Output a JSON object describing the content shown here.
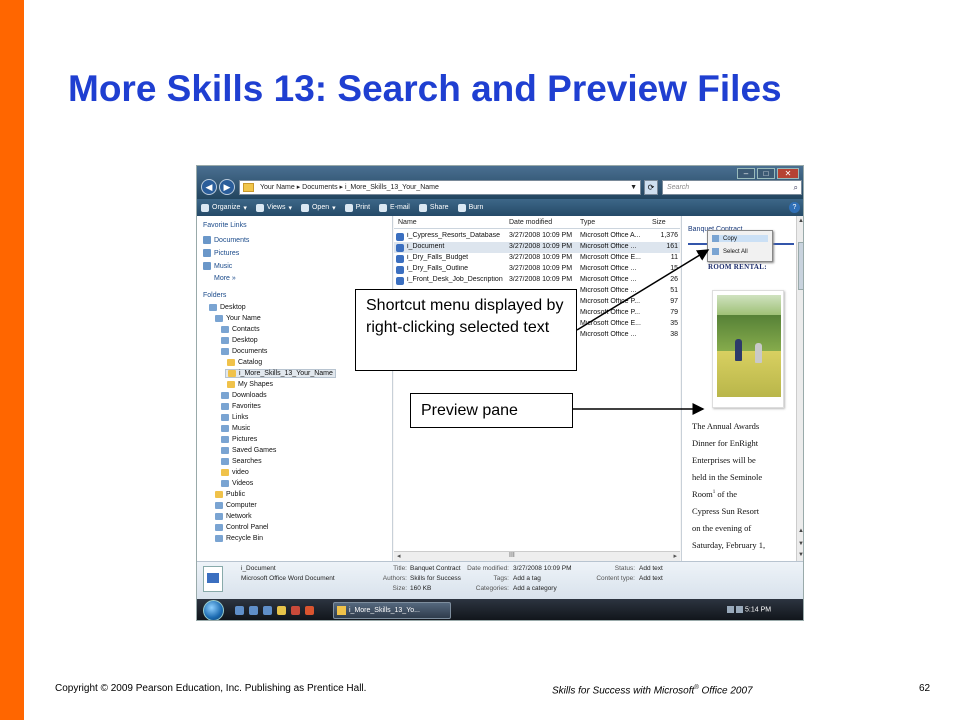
{
  "slide": {
    "title": "More Skills 13: Search and Preview Files",
    "footer_left": "Copyright © 2009 Pearson Education, Inc. Publishing as Prentice Hall.",
    "footer_center_prefix": "Skills for Success with Microsoft",
    "footer_center_mark": "®",
    "footer_center_suffix": " Office 2007",
    "page_number": "62",
    "accent_color": "#ff6600",
    "title_color": "#1f3fd1"
  },
  "callouts": {
    "shortcut_menu": "Shortcut menu displayed by right-clicking selected text",
    "preview_pane": "Preview pane"
  },
  "window": {
    "address": "Your Name  ▸  Documents  ▸  i_More_Skills_13_Your_Name",
    "search_placeholder": "Search",
    "toolbar": {
      "organize": "Organize",
      "views": "Views",
      "open": "Open",
      "print": "Print",
      "email": "E-mail",
      "share": "Share",
      "burn": "Burn",
      "help": "?"
    },
    "nav": {
      "favorite_links_header": "Favorite Links",
      "favorites": [
        "Documents",
        "Pictures",
        "Music"
      ],
      "more": "More  »",
      "folders_header": "Folders",
      "tree": [
        "Desktop",
        "Your Name",
        "Contacts",
        "Desktop",
        "Documents",
        "Catalog",
        "i_More_Skills_13_Your_Name",
        "My Shapes",
        "Downloads",
        "Favorites",
        "Links",
        "Music",
        "Pictures",
        "Saved Games",
        "Searches",
        "video",
        "Videos",
        "Public",
        "Computer",
        "Network",
        "Control Panel",
        "Recycle Bin"
      ]
    },
    "files": {
      "columns": [
        "Name",
        "Date modified",
        "Type",
        "Size"
      ],
      "rows": [
        {
          "name": "i_Cypress_Resorts_Database",
          "date": "3/27/2008 10:09 PM",
          "type": "Microsoft Office A...",
          "size": "1,376"
        },
        {
          "name": "i_Document",
          "date": "3/27/2008 10:09 PM",
          "type": "Microsoft Office ...",
          "size": "161"
        },
        {
          "name": "i_Dry_Falls_Budget",
          "date": "3/27/2008 10:09 PM",
          "type": "Microsoft Office E...",
          "size": "11"
        },
        {
          "name": "i_Dry_Falls_Outline",
          "date": "3/27/2008 10:09 PM",
          "type": "Microsoft Office ...",
          "size": "15"
        },
        {
          "name": "i_Front_Desk_Job_Description",
          "date": "3/27/2008 10:09 PM",
          "type": "Microsoft Office ...",
          "size": "26"
        },
        {
          "name": "",
          "date": "",
          "type": "Microsoft Office ...",
          "size": "51"
        },
        {
          "name": "",
          "date": "",
          "type": "Microsoft Office P...",
          "size": "97"
        },
        {
          "name": "",
          "date": "",
          "type": "Microsoft Office P...",
          "size": "79"
        },
        {
          "name": "",
          "date": "",
          "type": "Microsoft Office E...",
          "size": "35"
        },
        {
          "name": "",
          "date": "",
          "type": "Microsoft Office ...",
          "size": "38"
        }
      ],
      "hscroll_mid": "III"
    },
    "context_menu": {
      "copy": "Copy",
      "select_all": "Select All"
    },
    "preview": {
      "heading": "Banquet Contract",
      "room_rental": "ROOM RENTAL:",
      "body_lines": [
        "The Annual Awards",
        "Dinner for EnRight",
        "Enterprises will be",
        "held in the Seminole",
        "Room",
        "of the",
        "Cypress Sun Resort",
        "on the evening of",
        "Saturday, February 1,"
      ],
      "footnote_mark": "1"
    },
    "details": {
      "file_name": "i_Document",
      "file_type": "Microsoft Office Word Document",
      "size_label": "Size:",
      "size_value": "160 KB",
      "title_label": "Title:",
      "title_value": "Banquet Contract",
      "authors_label": "Authors:",
      "authors_value": "Skills for Success",
      "date_label": "Date modified:",
      "date_value": "3/27/2008 10:09 PM",
      "tags_label": "Tags:",
      "tags_value": "Add a tag",
      "categories_label": "Categories:",
      "categories_value": "Add a category",
      "status_label": "Status:",
      "status_value": "Add text",
      "content_label": "Content type:",
      "content_value": "Add text"
    },
    "taskbar": {
      "task_button": "i_More_Skills_13_Yo...",
      "clock": "5:14 PM"
    }
  }
}
